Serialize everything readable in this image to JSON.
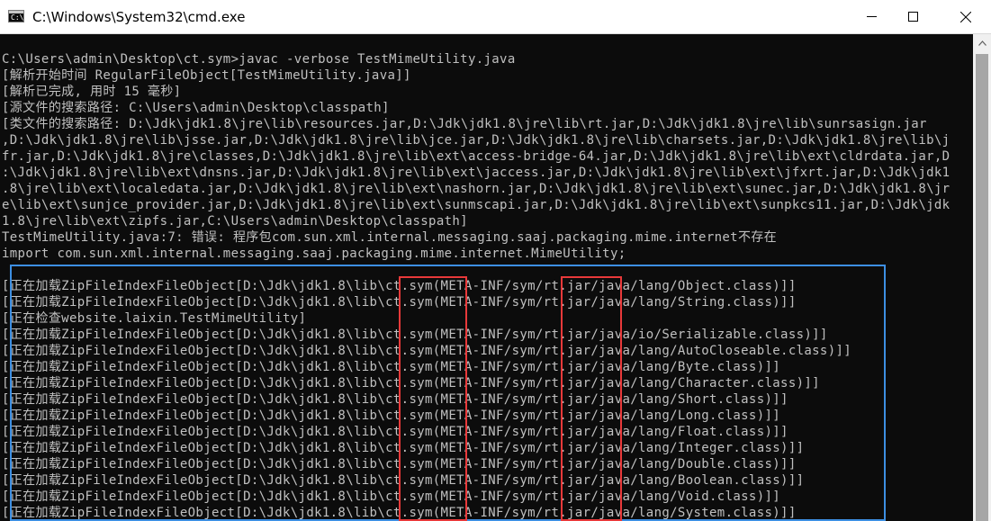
{
  "window": {
    "title": "C:\\Windows\\System32\\cmd.exe",
    "icon": "cmd-icon",
    "icon_prompt": "C:\\",
    "controls": [
      "minimize-icon",
      "maximize-icon",
      "close-icon"
    ]
  },
  "colors": {
    "console_bg": "#0c0c0c",
    "console_text": "#c0c0c0",
    "highlight_blue": "#3d8fe2",
    "highlight_red": "#e8393a"
  },
  "console": {
    "lines": [
      "C:\\Users\\admin\\Desktop\\ct.sym>javac -verbose TestMimeUtility.java",
      "[解析开始时间 RegularFileObject[TestMimeUtility.java]]",
      "[解析已完成, 用时 15 毫秒]",
      "[源文件的搜索路径: C:\\Users\\admin\\Desktop\\classpath]",
      "[类文件的搜索路径: D:\\Jdk\\jdk1.8\\jre\\lib\\resources.jar,D:\\Jdk\\jdk1.8\\jre\\lib\\rt.jar,D:\\Jdk\\jdk1.8\\jre\\lib\\sunrsasign.jar",
      ",D:\\Jdk\\jdk1.8\\jre\\lib\\jsse.jar,D:\\Jdk\\jdk1.8\\jre\\lib\\jce.jar,D:\\Jdk\\jdk1.8\\jre\\lib\\charsets.jar,D:\\Jdk\\jdk1.8\\jre\\lib\\j",
      "fr.jar,D:\\Jdk\\jdk1.8\\jre\\classes,D:\\Jdk\\jdk1.8\\jre\\lib\\ext\\access-bridge-64.jar,D:\\Jdk\\jdk1.8\\jre\\lib\\ext\\cldrdata.jar,D",
      ":\\Jdk\\jdk1.8\\jre\\lib\\ext\\dnsns.jar,D:\\Jdk\\jdk1.8\\jre\\lib\\ext\\jaccess.jar,D:\\Jdk\\jdk1.8\\jre\\lib\\ext\\jfxrt.jar,D:\\Jdk\\jdk1",
      ".8\\jre\\lib\\ext\\localedata.jar,D:\\Jdk\\jdk1.8\\jre\\lib\\ext\\nashorn.jar,D:\\Jdk\\jdk1.8\\jre\\lib\\ext\\sunec.jar,D:\\Jdk\\jdk1.8\\jr",
      "e\\lib\\ext\\sunjce_provider.jar,D:\\Jdk\\jdk1.8\\jre\\lib\\ext\\sunmscapi.jar,D:\\Jdk\\jdk1.8\\jre\\lib\\ext\\sunpkcs11.jar,D:\\Jdk\\jdk",
      "1.8\\jre\\lib\\ext\\zipfs.jar,C:\\Users\\admin\\Desktop\\classpath]",
      "TestMimeUtility.java:7: 错误: 程序包com.sun.xml.internal.messaging.saaj.packaging.mime.internet不存在",
      "import com.sun.xml.internal.messaging.saaj.packaging.mime.internet.MimeUtility;",
      "",
      "[正在加载ZipFileIndexFileObject[D:\\Jdk\\jdk1.8\\lib\\ct.sym(META-INF/sym/rt.jar/java/lang/Object.class)]]",
      "[正在加载ZipFileIndexFileObject[D:\\Jdk\\jdk1.8\\lib\\ct.sym(META-INF/sym/rt.jar/java/lang/String.class)]]",
      "[正在检查website.laixin.TestMimeUtility]",
      "[正在加载ZipFileIndexFileObject[D:\\Jdk\\jdk1.8\\lib\\ct.sym(META-INF/sym/rt.jar/java/io/Serializable.class)]]",
      "[正在加载ZipFileIndexFileObject[D:\\Jdk\\jdk1.8\\lib\\ct.sym(META-INF/sym/rt.jar/java/lang/AutoCloseable.class)]]",
      "[正在加载ZipFileIndexFileObject[D:\\Jdk\\jdk1.8\\lib\\ct.sym(META-INF/sym/rt.jar/java/lang/Byte.class)]]",
      "[正在加载ZipFileIndexFileObject[D:\\Jdk\\jdk1.8\\lib\\ct.sym(META-INF/sym/rt.jar/java/lang/Character.class)]]",
      "[正在加载ZipFileIndexFileObject[D:\\Jdk\\jdk1.8\\lib\\ct.sym(META-INF/sym/rt.jar/java/lang/Short.class)]]",
      "[正在加载ZipFileIndexFileObject[D:\\Jdk\\jdk1.8\\lib\\ct.sym(META-INF/sym/rt.jar/java/lang/Long.class)]]",
      "[正在加载ZipFileIndexFileObject[D:\\Jdk\\jdk1.8\\lib\\ct.sym(META-INF/sym/rt.jar/java/lang/Float.class)]]",
      "[正在加载ZipFileIndexFileObject[D:\\Jdk\\jdk1.8\\lib\\ct.sym(META-INF/sym/rt.jar/java/lang/Integer.class)]]",
      "[正在加载ZipFileIndexFileObject[D:\\Jdk\\jdk1.8\\lib\\ct.sym(META-INF/sym/rt.jar/java/lang/Double.class)]]",
      "[正在加载ZipFileIndexFileObject[D:\\Jdk\\jdk1.8\\lib\\ct.sym(META-INF/sym/rt.jar/java/lang/Boolean.class)]]",
      "[正在加载ZipFileIndexFileObject[D:\\Jdk\\jdk1.8\\lib\\ct.sym(META-INF/sym/rt.jar/java/lang/Void.class)]]",
      "[正在加载ZipFileIndexFileObject[D:\\Jdk\\jdk1.8\\lib\\ct.sym(META-INF/sym/rt.jar/java/lang/System.class)]]"
    ]
  }
}
